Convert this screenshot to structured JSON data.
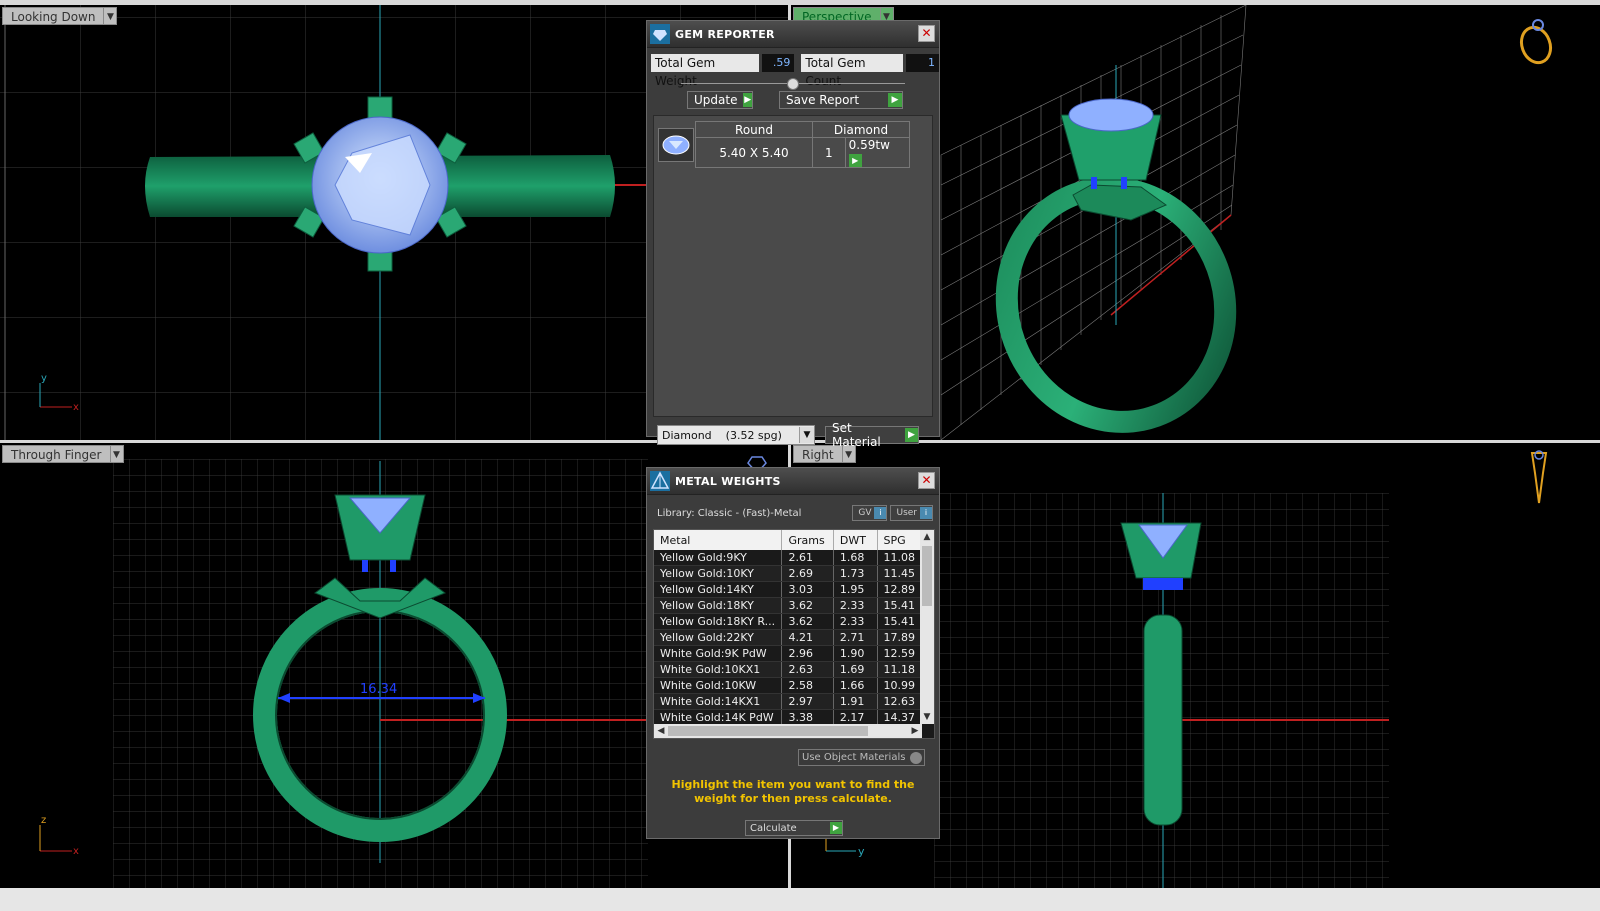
{
  "viewports": {
    "top_left": {
      "label": "Looking Down"
    },
    "top_right": {
      "label": "Perspective"
    },
    "bottom_left": {
      "label": "Through Finger"
    },
    "bottom_right": {
      "label": "Right"
    }
  },
  "axis_labels": {
    "x": "x",
    "y": "y",
    "z": "z"
  },
  "dimension_text": "16.34",
  "gem_reporter": {
    "title": "GEM REPORTER",
    "total_weight_label": "Total Gem Weight",
    "total_weight_value": ".59",
    "total_count_label": "Total Gem Count",
    "total_count_value": "1",
    "update_label": "Update",
    "save_report_label": "Save Report",
    "gem": {
      "shape": "Round",
      "material": "Diamond",
      "size": "5.40 X 5.40",
      "count": "1",
      "weight": "0.59tw"
    },
    "material_select": "Diamond    (3.52 spg)",
    "set_material_label": "Set Material"
  },
  "metal_weights": {
    "title": "METAL WEIGHTS",
    "library": "Library: Classic - (Fast)-Metal",
    "gv_label": "GV",
    "user_label": "User",
    "columns": [
      "Metal",
      "Grams",
      "DWT",
      "SPG"
    ],
    "rows": [
      [
        "Yellow Gold:9KY",
        "2.61",
        "1.68",
        "11.08"
      ],
      [
        "Yellow Gold:10KY",
        "2.69",
        "1.73",
        "11.45"
      ],
      [
        "Yellow Gold:14KY",
        "3.03",
        "1.95",
        "12.89"
      ],
      [
        "Yellow Gold:18KY",
        "3.62",
        "2.33",
        "15.41"
      ],
      [
        "Yellow Gold:18KY R...",
        "3.62",
        "2.33",
        "15.41"
      ],
      [
        "Yellow Gold:22KY",
        "4.21",
        "2.71",
        "17.89"
      ],
      [
        "White Gold:9K PdW",
        "2.96",
        "1.90",
        "12.59"
      ],
      [
        "White Gold:10KX1",
        "2.63",
        "1.69",
        "11.18"
      ],
      [
        "White Gold:10KW",
        "2.58",
        "1.66",
        "10.99"
      ],
      [
        "White Gold:14KX1",
        "2.97",
        "1.91",
        "12.63"
      ],
      [
        "White Gold:14K PdW",
        "3.38",
        "2.17",
        "14.37"
      ]
    ],
    "use_object_materials": "Use Object Materials",
    "instruction": "Highlight the item you want to find the weight for then press calculate.",
    "calculate_label": "Calculate"
  }
}
